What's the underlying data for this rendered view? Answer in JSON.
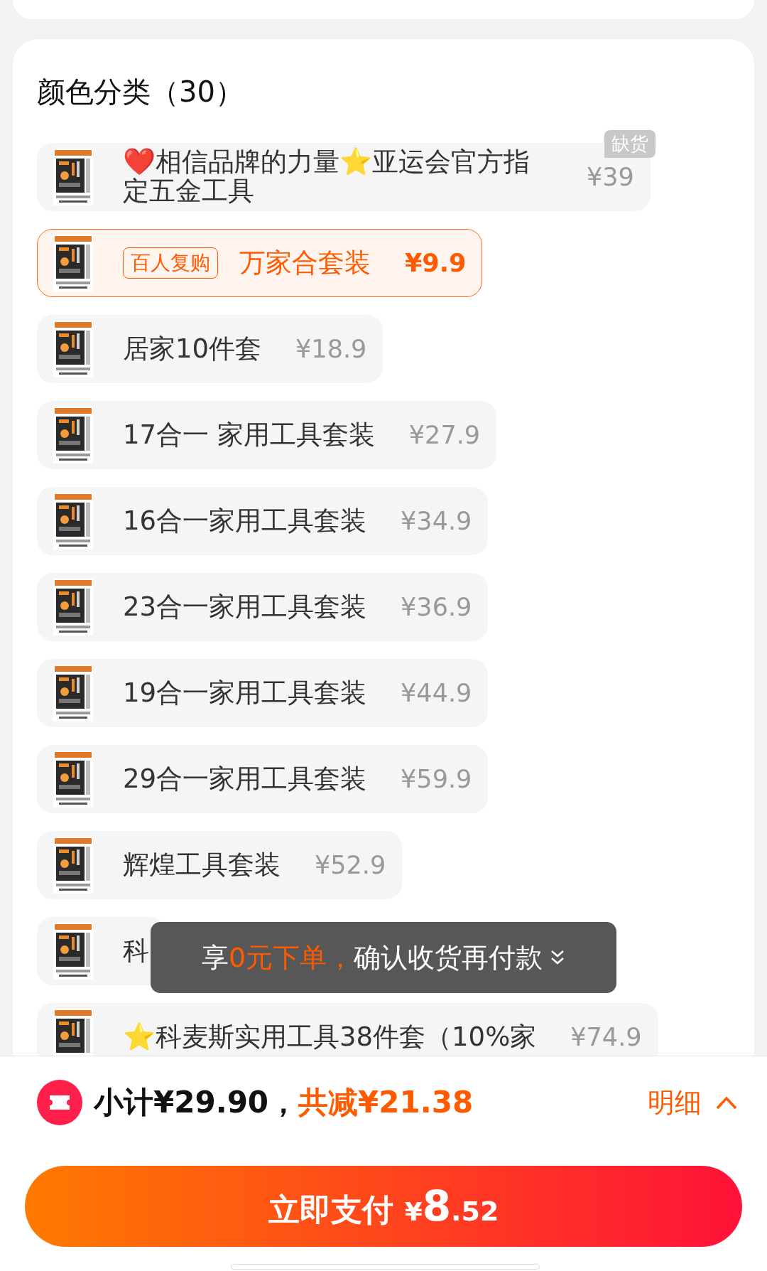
{
  "section": {
    "title": "颜色分类（30）"
  },
  "options": [
    {
      "name": "❤️相信品牌的力量⭐亚运会官方指定五金工具",
      "price": "¥39",
      "selected": false,
      "badge": "缺货"
    },
    {
      "name": "万家合套装",
      "price": "¥9.9",
      "selected": true,
      "tag": "百人复购"
    },
    {
      "name": "居家10件套",
      "price": "¥18.9",
      "selected": false
    },
    {
      "name": "17合一 家用工具套装",
      "price": "¥27.9",
      "selected": false
    },
    {
      "name": "16合一家用工具套装",
      "price": "¥34.9",
      "selected": false
    },
    {
      "name": "23合一家用工具套装",
      "price": "¥36.9",
      "selected": false
    },
    {
      "name": "19合一家用工具套装",
      "price": "¥44.9",
      "selected": false
    },
    {
      "name": "29合一家用工具套装",
      "price": "¥59.9",
      "selected": false
    },
    {
      "name": "辉煌工具套装",
      "price": "¥52.9",
      "selected": false
    },
    {
      "name": "科",
      "selected": false
    },
    {
      "name": "⭐科麦斯实用工具38件套（10%家",
      "price": "¥74.9",
      "selected": false
    }
  ],
  "toast": {
    "segments": [
      {
        "text": "享",
        "highlight": false
      },
      {
        "text": "0元下单，",
        "highlight": true
      },
      {
        "text": "确认收货再付款",
        "highlight": false
      }
    ]
  },
  "summary": {
    "subtotal": "小计¥29.90，",
    "discount": "共减¥21.38",
    "details_link": "明细"
  },
  "pay_button": {
    "label": "立即支付",
    "currency": "¥",
    "integer": "8",
    "decimal": ".52"
  }
}
